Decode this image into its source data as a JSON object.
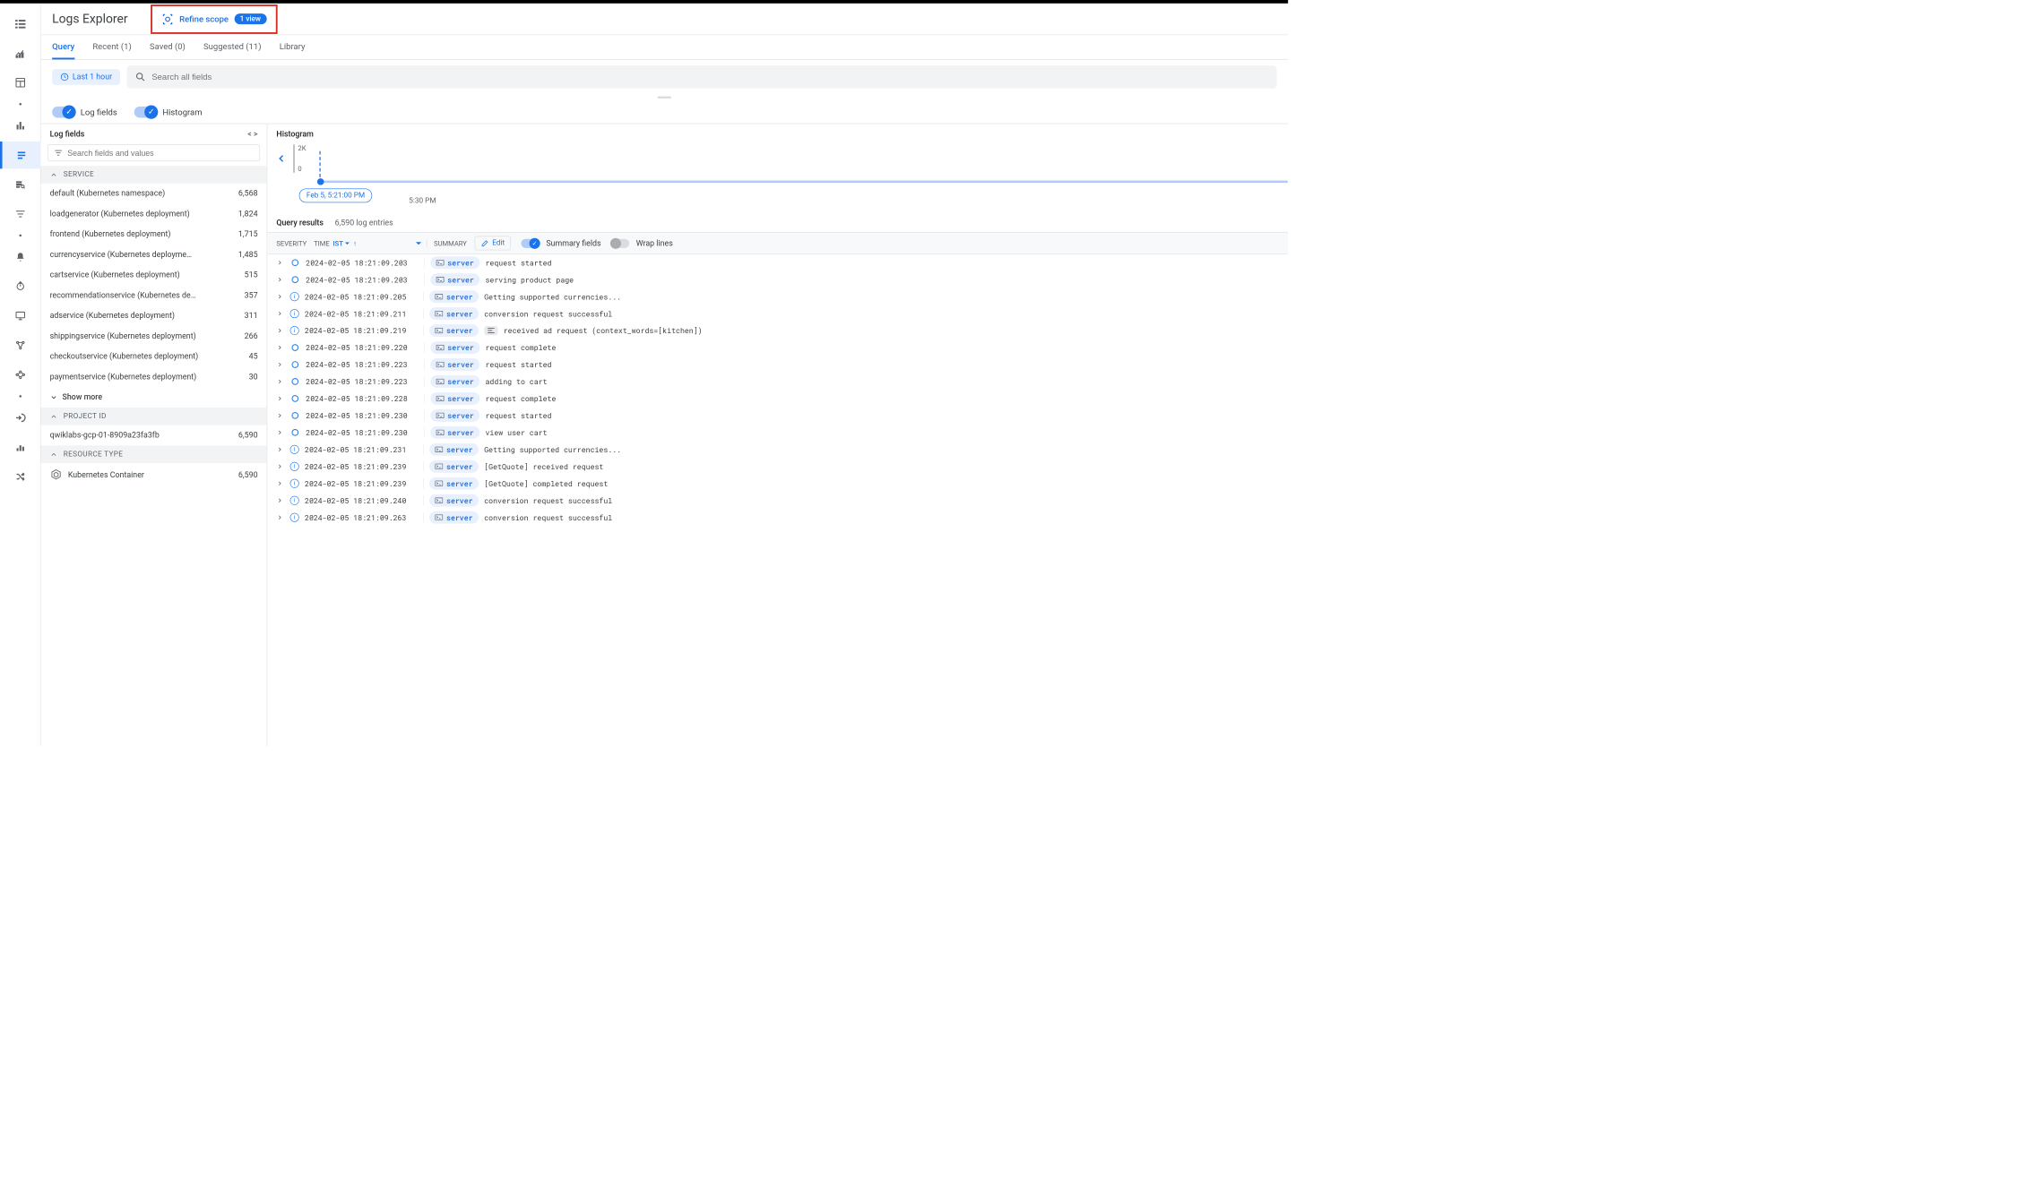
{
  "header": {
    "title": "Logs Explorer",
    "refine_label": "Refine scope",
    "refine_badge": "1 view"
  },
  "tabs": [
    {
      "label": "Query",
      "active": true
    },
    {
      "label": "Recent (1)",
      "active": false
    },
    {
      "label": "Saved (0)",
      "active": false
    },
    {
      "label": "Suggested (11)",
      "active": false
    },
    {
      "label": "Library",
      "active": false
    }
  ],
  "time_chip": "Last 1 hour",
  "search_placeholder": "Search all fields",
  "toggles": {
    "log_fields": "Log fields",
    "histogram": "Histogram"
  },
  "sidebar": {
    "title": "Log fields",
    "search_placeholder": "Search fields and values",
    "groups": [
      {
        "name": "SERVICE",
        "items": [
          {
            "label": "default (Kubernetes namespace)",
            "count": "6,568"
          },
          {
            "label": "loadgenerator (Kubernetes deployment)",
            "count": "1,824"
          },
          {
            "label": "frontend (Kubernetes deployment)",
            "count": "1,715"
          },
          {
            "label": "currencyservice (Kubernetes deployme…",
            "count": "1,485"
          },
          {
            "label": "cartservice (Kubernetes deployment)",
            "count": "515"
          },
          {
            "label": "recommendationservice (Kubernetes de…",
            "count": "357"
          },
          {
            "label": "adservice (Kubernetes deployment)",
            "count": "311"
          },
          {
            "label": "shippingservice (Kubernetes deployment)",
            "count": "266"
          },
          {
            "label": "checkoutservice (Kubernetes deployment)",
            "count": "45"
          },
          {
            "label": "paymentservice (Kubernetes deployment)",
            "count": "30"
          }
        ],
        "show_more": "Show more"
      },
      {
        "name": "PROJECT ID",
        "items": [
          {
            "label": "qwiklabs-gcp-01-8909a23fa3fb",
            "count": "6,590"
          }
        ]
      },
      {
        "name": "RESOURCE TYPE",
        "items": [
          {
            "label": "Kubernetes Container",
            "count": "6,590",
            "icon": "hex"
          }
        ]
      }
    ]
  },
  "histogram": {
    "title": "Histogram",
    "ymax": "2K",
    "ymin": "0",
    "bubble": "Feb 5, 5:21:00 PM",
    "ticks": [
      "5:30 PM"
    ]
  },
  "results": {
    "title": "Query results",
    "count": "6,590 log entries",
    "columns": {
      "severity": "SEVERITY",
      "time": "TIME",
      "tz": "IST",
      "summary": "SUMMARY",
      "edit": "Edit",
      "summary_fields": "Summary fields",
      "wrap": "Wrap lines"
    }
  },
  "logs": [
    {
      "sev": "debug",
      "ts": "2024-02-05 18:21:09.203",
      "chip": "server",
      "msg": "request started"
    },
    {
      "sev": "debug",
      "ts": "2024-02-05 18:21:09.203",
      "chip": "server",
      "msg": "serving product page"
    },
    {
      "sev": "info",
      "ts": "2024-02-05 18:21:09.205",
      "chip": "server",
      "msg": "Getting supported currencies..."
    },
    {
      "sev": "info",
      "ts": "2024-02-05 18:21:09.211",
      "chip": "server",
      "msg": "conversion request successful"
    },
    {
      "sev": "info",
      "ts": "2024-02-05 18:21:09.219",
      "chip": "server",
      "msg": "received ad request (context_words=[kitchen])",
      "align": true
    },
    {
      "sev": "debug",
      "ts": "2024-02-05 18:21:09.220",
      "chip": "server",
      "msg": "request complete"
    },
    {
      "sev": "debug",
      "ts": "2024-02-05 18:21:09.223",
      "chip": "server",
      "msg": "request started"
    },
    {
      "sev": "debug",
      "ts": "2024-02-05 18:21:09.223",
      "chip": "server",
      "msg": "adding to cart"
    },
    {
      "sev": "debug",
      "ts": "2024-02-05 18:21:09.228",
      "chip": "server",
      "msg": "request complete"
    },
    {
      "sev": "debug",
      "ts": "2024-02-05 18:21:09.230",
      "chip": "server",
      "msg": "request started"
    },
    {
      "sev": "debug",
      "ts": "2024-02-05 18:21:09.230",
      "chip": "server",
      "msg": "view user cart"
    },
    {
      "sev": "info",
      "ts": "2024-02-05 18:21:09.231",
      "chip": "server",
      "msg": "Getting supported currencies..."
    },
    {
      "sev": "info",
      "ts": "2024-02-05 18:21:09.239",
      "chip": "server",
      "msg": "[GetQuote] received request"
    },
    {
      "sev": "info",
      "ts": "2024-02-05 18:21:09.239",
      "chip": "server",
      "msg": "[GetQuote] completed request"
    },
    {
      "sev": "info",
      "ts": "2024-02-05 18:21:09.240",
      "chip": "server",
      "msg": "conversion request successful"
    },
    {
      "sev": "info",
      "ts": "2024-02-05 18:21:09.263",
      "chip": "server",
      "msg": "conversion request successful"
    }
  ]
}
